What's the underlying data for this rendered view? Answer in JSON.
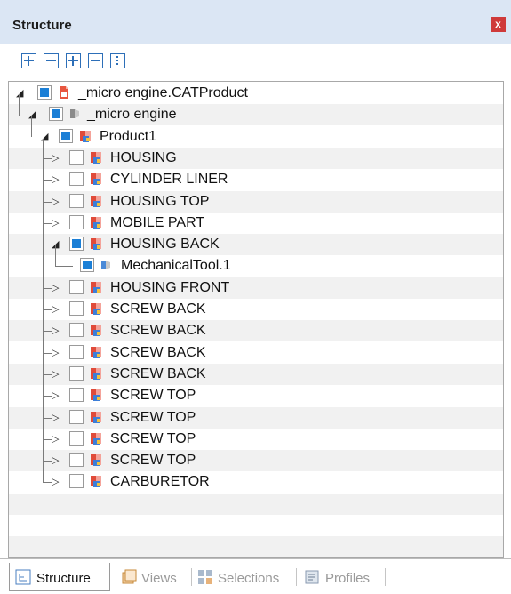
{
  "panel": {
    "title": "Structure",
    "close_symbol": "x"
  },
  "toolbar": {
    "buttons": [
      {
        "icon": "expand-all-icon"
      },
      {
        "icon": "collapse-all-icon"
      },
      {
        "icon": "expand-icon"
      },
      {
        "icon": "collapse-icon"
      },
      {
        "icon": "split-icon"
      }
    ]
  },
  "tree": {
    "root": {
      "label": "_micro engine.CATProduct",
      "checked": true,
      "expanded": true,
      "icon": "catproduct-file-icon"
    },
    "engine": {
      "label": "_micro engine",
      "checked": true,
      "expanded": true,
      "icon": "engine-part-icon"
    },
    "product": {
      "label": "Product1",
      "checked": true,
      "expanded": true,
      "icon": "product-icon"
    },
    "items": [
      {
        "label": "HOUSING",
        "checked": false,
        "expanded": false
      },
      {
        "label": "CYLINDER LINER",
        "checked": false,
        "expanded": false
      },
      {
        "label": "HOUSING TOP",
        "checked": false,
        "expanded": false
      },
      {
        "label": "MOBILE PART",
        "checked": false,
        "expanded": false
      },
      {
        "label": "HOUSING BACK",
        "checked": true,
        "expanded": true
      },
      {
        "label": "MechanicalTool.1",
        "checked": true,
        "expanded": false,
        "child": true
      },
      {
        "label": "HOUSING FRONT",
        "checked": false,
        "expanded": false
      },
      {
        "label": "SCREW BACK",
        "checked": false,
        "expanded": false
      },
      {
        "label": "SCREW BACK",
        "checked": false,
        "expanded": false
      },
      {
        "label": "SCREW BACK",
        "checked": false,
        "expanded": false
      },
      {
        "label": "SCREW BACK",
        "checked": false,
        "expanded": false
      },
      {
        "label": "SCREW TOP",
        "checked": false,
        "expanded": false
      },
      {
        "label": "SCREW TOP",
        "checked": false,
        "expanded": false
      },
      {
        "label": "SCREW TOP",
        "checked": false,
        "expanded": false
      },
      {
        "label": "SCREW TOP",
        "checked": false,
        "expanded": false
      },
      {
        "label": "CARBURETOR",
        "checked": false,
        "expanded": false
      }
    ]
  },
  "tabs": [
    {
      "label": "Structure",
      "active": true,
      "icon": "structure-tab-icon"
    },
    {
      "label": "Views",
      "active": false,
      "icon": "views-tab-icon"
    },
    {
      "label": "Selections",
      "active": false,
      "icon": "selections-tab-icon"
    },
    {
      "label": "Profiles",
      "active": false,
      "icon": "profiles-tab-icon"
    }
  ],
  "colors": {
    "checkbox_checked": "#1b7fd6",
    "accent": "#2d6fb8",
    "close_button": "#cf3a3a",
    "titlebar": "#dbe6f4"
  }
}
